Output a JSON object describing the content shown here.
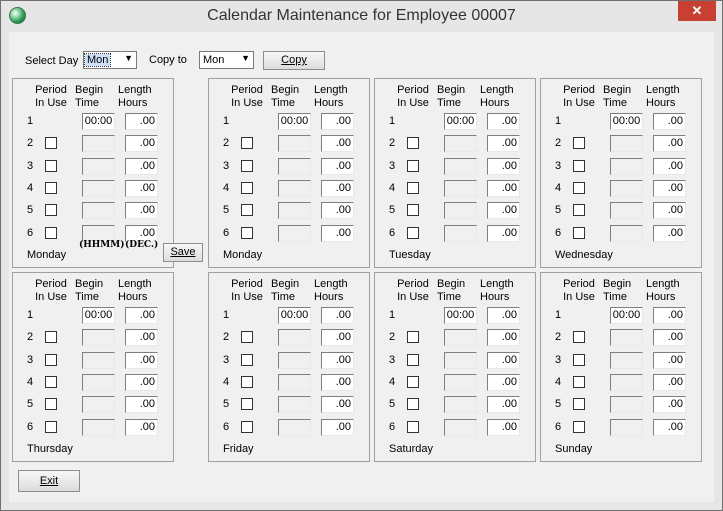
{
  "window": {
    "title": "Calendar Maintenance for Employee 00007",
    "close_glyph": "✕"
  },
  "toolbar": {
    "select_day_label": "Select Day",
    "select_day_value": "Mon",
    "copy_to_label": "Copy to",
    "copy_to_value": "Mon",
    "copy_button": "Copy"
  },
  "headers": {
    "period_l1": "Period",
    "period_l2": "In Use",
    "begin_l1": "Begin",
    "begin_l2": "Time",
    "length_l1": "Length",
    "length_l2": "Hours"
  },
  "row_labels": [
    "1",
    "2",
    "3",
    "4",
    "5",
    "6"
  ],
  "default_time": "00:00",
  "default_length": ".00",
  "edit_panel": {
    "format_time": "(HHMM)",
    "format_length": "(DEC.)",
    "save_button": "Save"
  },
  "panels": [
    {
      "day": "Monday"
    },
    {
      "day": "Monday"
    },
    {
      "day": "Tuesday"
    },
    {
      "day": "Wednesday"
    },
    {
      "day": "Thursday"
    },
    {
      "day": "Friday"
    },
    {
      "day": "Saturday"
    },
    {
      "day": "Sunday"
    }
  ],
  "footer": {
    "exit_button": "Exit"
  }
}
